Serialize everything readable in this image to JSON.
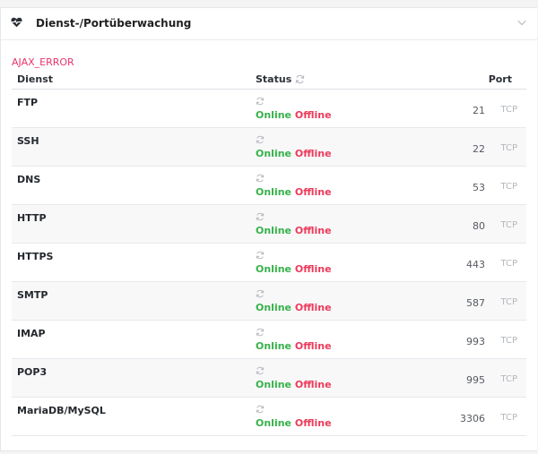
{
  "panel": {
    "title": "Dienst-/Portüberwachung",
    "icon": "heart-pulse-icon"
  },
  "error_text": "AJAX_ERROR",
  "table": {
    "headers": {
      "service": "Dienst",
      "status": "Status",
      "port": "Port"
    },
    "rows": [
      {
        "name": "FTP",
        "online": "Online",
        "offline": "Offline",
        "port": "21",
        "protocol": "TCP"
      },
      {
        "name": "SSH",
        "online": "Online",
        "offline": "Offline",
        "port": "22",
        "protocol": "TCP"
      },
      {
        "name": "DNS",
        "online": "Online",
        "offline": "Offline",
        "port": "53",
        "protocol": "TCP"
      },
      {
        "name": "HTTP",
        "online": "Online",
        "offline": "Offline",
        "port": "80",
        "protocol": "TCP"
      },
      {
        "name": "HTTPS",
        "online": "Online",
        "offline": "Offline",
        "port": "443",
        "protocol": "TCP"
      },
      {
        "name": "SMTP",
        "online": "Online",
        "offline": "Offline",
        "port": "587",
        "protocol": "TCP"
      },
      {
        "name": "IMAP",
        "online": "Online",
        "offline": "Offline",
        "port": "993",
        "protocol": "TCP"
      },
      {
        "name": "POP3",
        "online": "Online",
        "offline": "Offline",
        "port": "995",
        "protocol": "TCP"
      },
      {
        "name": "MariaDB/MySQL",
        "online": "Online",
        "offline": "Offline",
        "port": "3306",
        "protocol": "TCP"
      }
    ]
  },
  "colors": {
    "online": "#36b24a",
    "offline": "#ec3b5b",
    "error": "#e8336c"
  }
}
